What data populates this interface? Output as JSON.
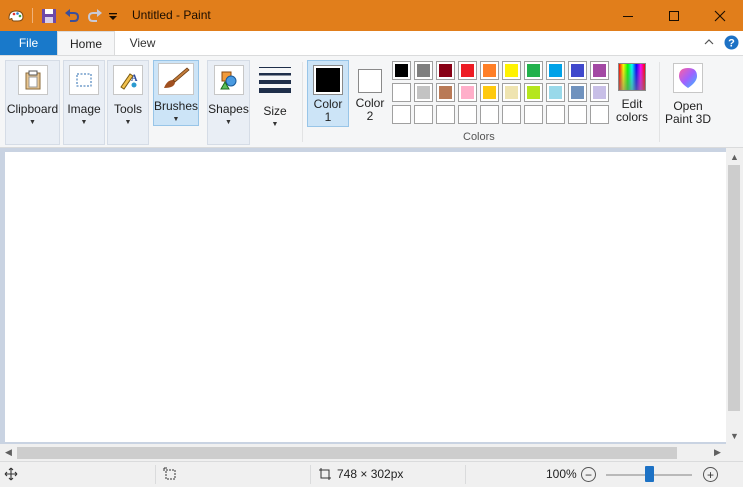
{
  "titlebar": {
    "title": "Untitled - Paint",
    "bg_color": "#e17e1b",
    "quick_access": [
      "paint-app-icon",
      "save-icon",
      "undo-icon",
      "redo-icon",
      "customize-dropdown-icon"
    ],
    "window_controls": [
      "minimize-icon",
      "maximize-icon",
      "close-icon"
    ]
  },
  "tabs": {
    "file": "File",
    "home": "Home",
    "view": "View",
    "right_icons": [
      "collapse-ribbon-icon",
      "help-icon"
    ]
  },
  "ribbon": {
    "clipboard": "Clipboard",
    "image": "Image",
    "tools": "Tools",
    "brushes": "Brushes",
    "shapes": "Shapes",
    "size": "Size",
    "color1_line1": "Color",
    "color1_line2": "1",
    "color2_line1": "Color",
    "color2_line2": "2",
    "colors_group_label": "Colors",
    "edit_colors_line1": "Edit",
    "edit_colors_line2": "colors",
    "open_paint3d_line1": "Open",
    "open_paint3d_line2": "Paint 3D",
    "color1_value": "#000000",
    "color2_value": "#ffffff",
    "palette_row1": [
      "#000000",
      "#7f7f7f",
      "#880015",
      "#ed1c24",
      "#ff7f27",
      "#fff200",
      "#22b14c",
      "#00a2e8",
      "#3f48cc",
      "#a349a4"
    ],
    "palette_row2": [
      "#ffffff",
      "#c3c3c3",
      "#b97a57",
      "#ffaec9",
      "#ffc90e",
      "#efe4b0",
      "#b5e61d",
      "#99d9ea",
      "#7092be",
      "#c8bfe7"
    ],
    "palette_row3_count": 10
  },
  "status": {
    "move_icon": "move-cursor-icon",
    "selection_icon": "selection-size-icon",
    "canvas_size_icon": "canvas-size-icon",
    "canvas_size": "748 × 302px",
    "zoom": "100%",
    "zoom_level_percent": 100
  }
}
